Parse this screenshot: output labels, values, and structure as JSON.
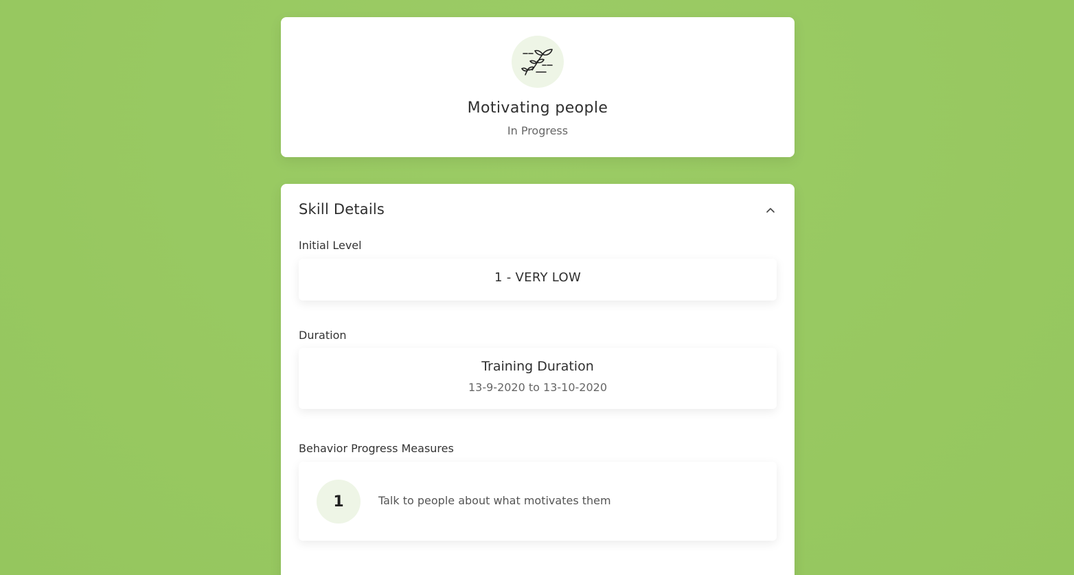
{
  "skill": {
    "icon": "sprouting-plant-icon",
    "title": "Motivating people",
    "status": "In Progress"
  },
  "details": {
    "title": "Skill Details",
    "collapse_icon": "chevron-up-icon",
    "initial_level": {
      "label": "Initial Level",
      "value": "1 - VERY LOW"
    },
    "duration": {
      "label": "Duration",
      "title": "Training Duration",
      "range": "13-9-2020 to 13-10-2020"
    },
    "measures": {
      "label": "Behavior Progress Measures",
      "items": [
        {
          "number": "1",
          "text": "Talk to people about what motivates them"
        }
      ]
    }
  },
  "colors": {
    "background": "#98ca60",
    "card": "#ffffff",
    "accent_light": "#eef5e6"
  }
}
